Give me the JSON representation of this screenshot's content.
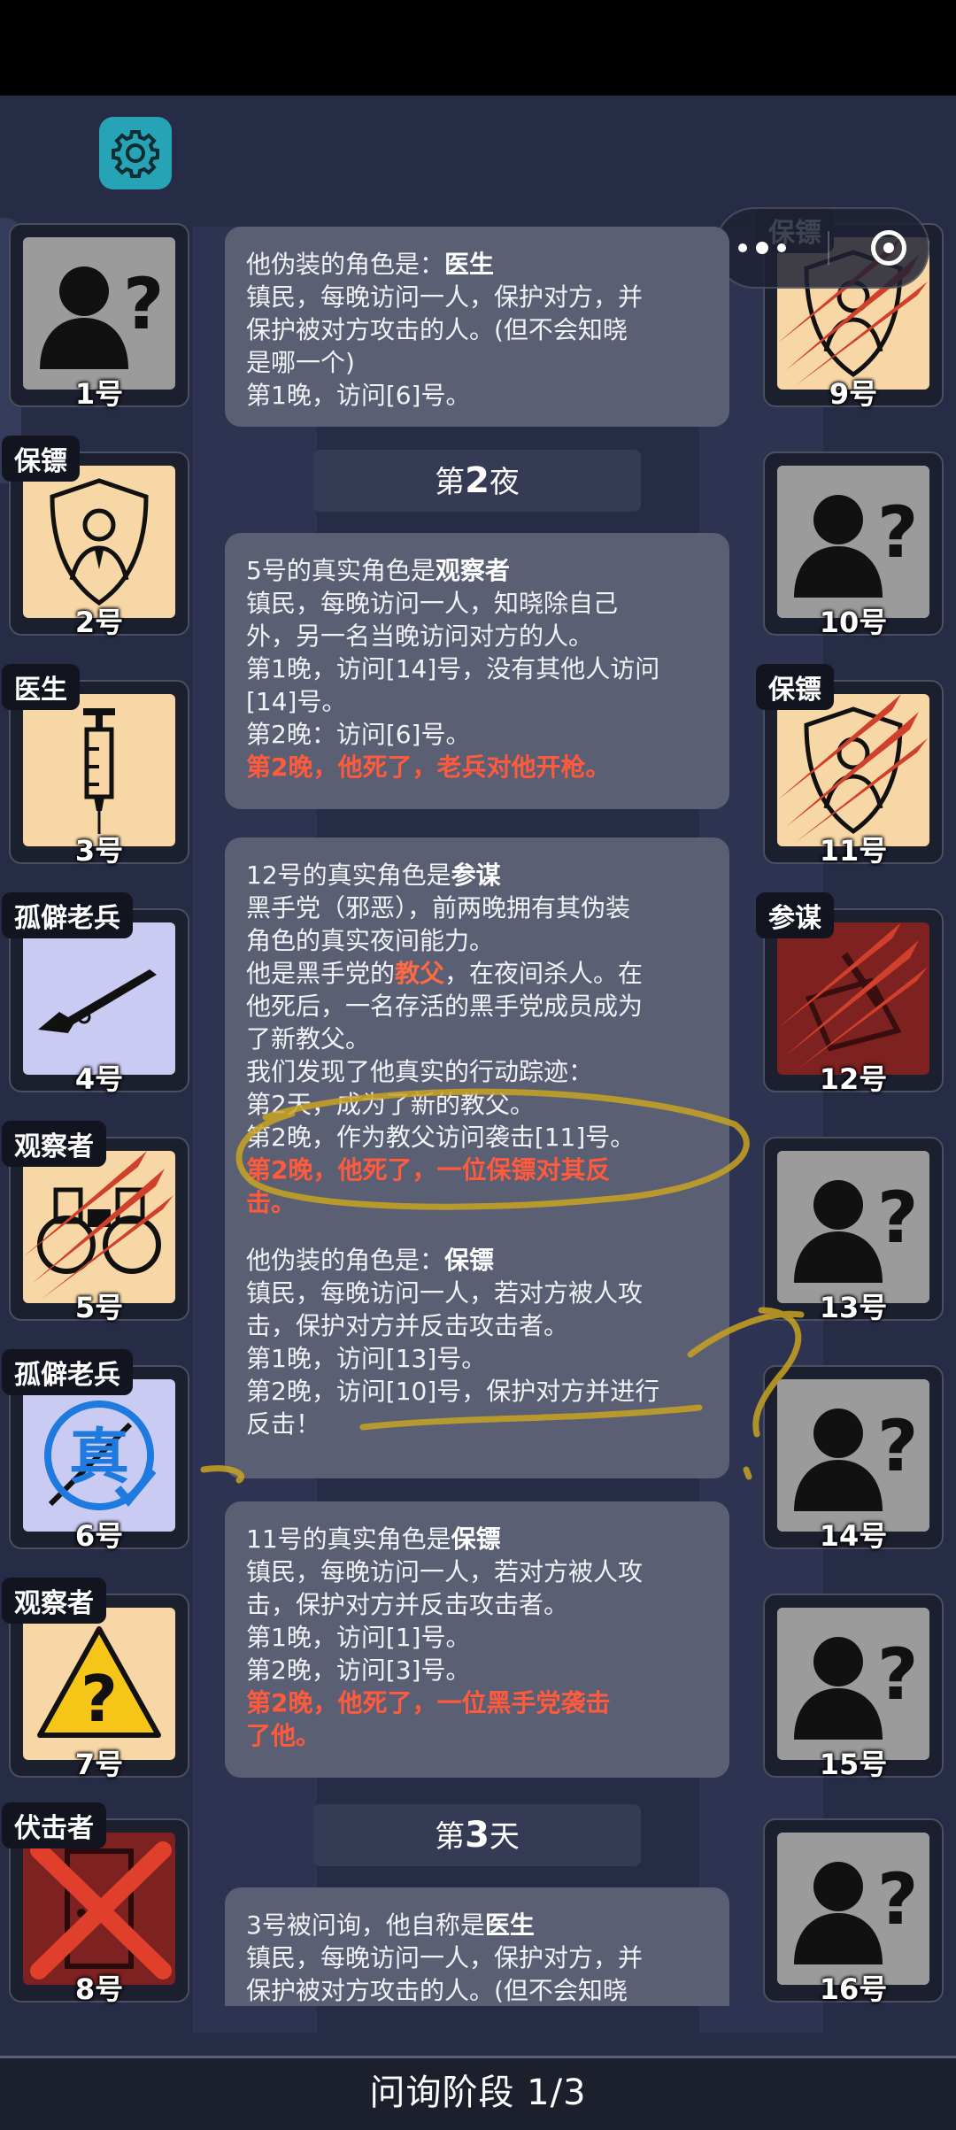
{
  "players_left": [
    {
      "num": "1号",
      "tag": "",
      "type": "unknown"
    },
    {
      "num": "2号",
      "tag": "保镖",
      "type": "bodyguard"
    },
    {
      "num": "3号",
      "tag": "医生",
      "type": "doctor"
    },
    {
      "num": "4号",
      "tag": "孤僻老兵",
      "type": "veteran"
    },
    {
      "num": "5号",
      "tag": "观察者",
      "type": "lookout-dead"
    },
    {
      "num": "6号",
      "tag": "孤僻老兵",
      "type": "veteran-true"
    },
    {
      "num": "7号",
      "tag": "观察者",
      "type": "lookout-warn"
    },
    {
      "num": "8号",
      "tag": "伏击者",
      "type": "ambusher-dead"
    }
  ],
  "players_right": [
    {
      "num": "9号",
      "tag": "保镖",
      "type": "bodyguard-dead"
    },
    {
      "num": "10号",
      "tag": "",
      "type": "unknown"
    },
    {
      "num": "11号",
      "tag": "保镖",
      "type": "bodyguard-dead"
    },
    {
      "num": "12号",
      "tag": "参谋",
      "type": "consigliere-dead"
    },
    {
      "num": "13号",
      "tag": "",
      "type": "unknown"
    },
    {
      "num": "14号",
      "tag": "",
      "type": "unknown"
    },
    {
      "num": "15号",
      "tag": "",
      "type": "unknown"
    },
    {
      "num": "16号",
      "tag": "",
      "type": "unknown"
    }
  ],
  "log": {
    "b1": {
      "l1a": "他伪装的角色是：",
      "l1b": "医生",
      "l2": "镇民，每晚访问一人，保护对方，并",
      "l3": "保护被对方攻击的人。(但不会知晓",
      "l4": "是哪一个)",
      "l5": "第1晚，访问[6]号。"
    },
    "h_night2": {
      "pre": "第",
      "n": "2",
      "post": "夜"
    },
    "b2": {
      "l1a": "5号的真实角色是",
      "l1b": "观察者",
      "l2": "镇民，每晚访问一人，知晓除自己",
      "l3": "外，另一名当晚访问对方的人。",
      "l4": "第1晚，访问[14]号，没有其他人访问",
      "l5": "[14]号。",
      "l6": "第2晚：访问[6]号。",
      "l7": "第2晚，他死了，老兵对他开枪。"
    },
    "b3": {
      "l1a": "12号的真实角色是",
      "l1b": "参谋",
      "l2": "黑手党（邪恶），前两晚拥有其伪装",
      "l3": "角色的真实夜间能力。",
      "l4a": "他是黑手党的",
      "l4b": "教父",
      "l4c": "，在夜间杀人。在",
      "l5": "他死后，一名存活的黑手党成员成为",
      "l6": "了新教父。",
      "l7": "我们发现了他真实的行动踪迹：",
      "l8": "第2天，成为了新的教父。",
      "l9": "第2晚，作为教父访问袭击[11]号。",
      "l10": "第2晚，他死了，一位保镖对其反",
      "l11": "击。",
      "l12a": "他伪装的角色是：",
      "l12b": "保镖",
      "l13": "镇民，每晚访问一人，若对方被人攻",
      "l14": "击，保护对方并反击攻击者。",
      "l15": "第1晚，访问[13]号。",
      "l16": "第2晚，访问[10]号，保护对方并进行",
      "l17": "反击！"
    },
    "b4": {
      "l1a": "11号的真实角色是",
      "l1b": "保镖",
      "l2": "镇民，每晚访问一人，若对方被人攻",
      "l3": "击，保护对方并反击攻击者。",
      "l4": "第1晚，访问[1]号。",
      "l5": "第2晚，访问[3]号。",
      "l6": "第2晚，他死了，一位黑手党袭击",
      "l7": "了他。"
    },
    "h_day3": {
      "pre": "第",
      "n": "3",
      "post": "天"
    },
    "b5": {
      "l1a": "3号被问询，他自称是",
      "l1b": "医生",
      "l2": "镇民，每晚访问一人，保护对方，并",
      "l3": "保护被对方攻击的人。(但不会知晓"
    }
  },
  "bottom": {
    "label": "问询阶段 1/3"
  },
  "icons": {
    "settings": "gear-icon",
    "menu": "more-dots-icon",
    "close": "target-close-icon"
  },
  "colors": {
    "background": "#262c45",
    "bubble": "#5a5f74",
    "death_text": "#ff5a3c",
    "gear": "#26a3b5"
  }
}
